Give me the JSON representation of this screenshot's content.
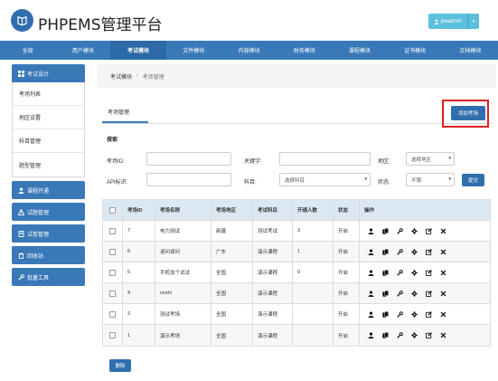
{
  "app": {
    "title": "PHPEMS管理平台",
    "user_label": "peadmin",
    "user_caret": "▾"
  },
  "topnav": {
    "items": [
      "全局",
      "用户模块",
      "考试模块",
      "文件模块",
      "内容模块",
      "财务模块",
      "课程模块",
      "证书模块",
      "文档模块"
    ],
    "active_index": 2
  },
  "sidebar": {
    "group_title": "考试设计",
    "items": [
      "考场列表",
      "地区设置",
      "科目管理",
      "题型管理"
    ],
    "blocks": [
      "课程开通",
      "试题管理",
      "试卷管理",
      "回收站",
      "批量工具"
    ]
  },
  "breadcrumb": {
    "root": "考试模块",
    "separator": "/",
    "current": "考场管理"
  },
  "tab": {
    "title": "考场管理",
    "add_button": "添加考场"
  },
  "search": {
    "title": "搜索",
    "labels": {
      "exam_id": "考场ID:",
      "keyword": "关键字:",
      "region": "地区:",
      "api_id": "API标识:",
      "subject": "科目:",
      "status": "状态:"
    },
    "region_select": "选择地区",
    "subject_select": "选择科目",
    "status_select": "不限",
    "submit": "提交"
  },
  "table": {
    "headers": [
      "考场ID",
      "考场名称",
      "考场地区",
      "考试科目",
      "开通人数",
      "状态",
      "操作"
    ],
    "rows": [
      {
        "id": "7",
        "name": "电力测试",
        "region": "新疆",
        "subject": "测试考试",
        "count": "3",
        "status": "开启"
      },
      {
        "id": "6",
        "name": "请问请问",
        "region": "广东",
        "subject": "演示课程",
        "count": "1",
        "status": "开启"
      },
      {
        "id": "5",
        "name": "手机加个试试",
        "region": "全国",
        "subject": "演示课程",
        "count": "0",
        "status": "开启"
      },
      {
        "id": "4",
        "name": "ceshi",
        "region": "全国",
        "subject": "演示课程",
        "count": "",
        "status": "开启"
      },
      {
        "id": "3",
        "name": "测试考场",
        "region": "全国",
        "subject": "演示课程",
        "count": "",
        "status": "开启"
      },
      {
        "id": "1",
        "name": "演示考场",
        "region": "全国",
        "subject": "演示课程",
        "count": "",
        "status": "开启"
      }
    ],
    "op_icons": [
      "user-icon",
      "copy-icon",
      "wrench-icon",
      "gear-icon",
      "edit-icon",
      "delete-icon"
    ]
  },
  "footer": {
    "delete_button": "删除"
  },
  "colors": {
    "primary": "#3a79b8",
    "button": "#2f6fad",
    "info": "#5bc0de",
    "highlight": "#e02020"
  }
}
